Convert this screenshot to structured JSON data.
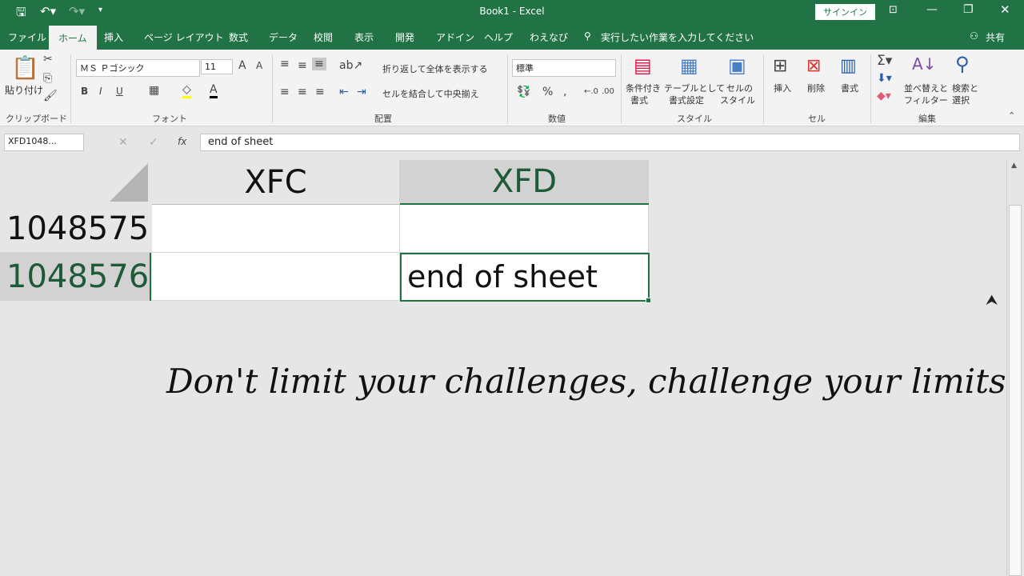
{
  "titlebar": {
    "title": "Book1  -  Excel",
    "signin": "サインイン"
  },
  "tabs": [
    "ファイル",
    "ホーム",
    "挿入",
    "ページ レイアウト",
    "数式",
    "データ",
    "校閲",
    "表示",
    "開発",
    "アドイン",
    "ヘルプ",
    "わえなび"
  ],
  "tell_me": "実行したい作業を入力してください",
  "share": "共有",
  "ribbon": {
    "paste": "貼り付け",
    "clipboard": "クリップボード",
    "font_name": "ＭＳ Ｐゴシック",
    "font_size": "11",
    "font": "フォント",
    "wrap": "折り返して全体を表示する",
    "merge": "セルを結合して中央揃え",
    "alignment": "配置",
    "number_format": "標準",
    "number": "数値",
    "cond_format": [
      "条件付き",
      "書式"
    ],
    "table_format": [
      "テーブルとして",
      "書式設定"
    ],
    "cell_style": [
      "セルの",
      "スタイル"
    ],
    "styles": "スタイル",
    "insert": "挿入",
    "delete": "削除",
    "format": "書式",
    "cells": "セル",
    "sort": [
      "並べ替えと",
      "フィルター"
    ],
    "find": [
      "検索と",
      "選択"
    ],
    "editing": "編集"
  },
  "formula_bar": {
    "name_box": "XFD1048...",
    "fx": "fx",
    "value": "end of sheet"
  },
  "grid": {
    "columns": [
      "XFC",
      "XFD"
    ],
    "rows": [
      {
        "num": "1048575",
        "cells": [
          "",
          ""
        ]
      },
      {
        "num": "1048576",
        "cells": [
          "",
          "end of sheet"
        ]
      }
    ],
    "selected_column": "XFD",
    "selected_row": "1048576"
  },
  "quote": "Don't limit your challenges, challenge your limits!!",
  "colors": {
    "accent": "#217346",
    "selected_header_text": "#1e5a37"
  }
}
